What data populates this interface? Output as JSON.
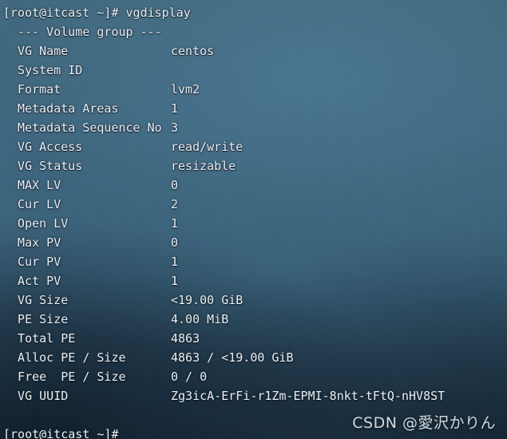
{
  "terminal": {
    "command_line": "[root@itcast ~]# vgdisplay",
    "section_header": "  --- Volume group ---",
    "final_prompt": "[root@itcast ~]#",
    "fields": [
      {
        "label": "  VG Name",
        "value": "centos"
      },
      {
        "label": "  System ID",
        "value": ""
      },
      {
        "label": "  Format",
        "value": "lvm2"
      },
      {
        "label": "  Metadata Areas",
        "value": "1"
      },
      {
        "label": "  Metadata Sequence No",
        "value": "3"
      },
      {
        "label": "  VG Access",
        "value": "read/write"
      },
      {
        "label": "  VG Status",
        "value": "resizable"
      },
      {
        "label": "  MAX LV",
        "value": "0"
      },
      {
        "label": "  Cur LV",
        "value": "2"
      },
      {
        "label": "  Open LV",
        "value": "1"
      },
      {
        "label": "  Max PV",
        "value": "0"
      },
      {
        "label": "  Cur PV",
        "value": "1"
      },
      {
        "label": "  Act PV",
        "value": "1"
      },
      {
        "label": "  VG Size",
        "value": "<19.00 GiB"
      },
      {
        "label": "  PE Size",
        "value": "4.00 MiB"
      },
      {
        "label": "  Total PE",
        "value": "4863"
      },
      {
        "label": "  Alloc PE / Size",
        "value": "4863 / <19.00 GiB"
      },
      {
        "label": "  Free  PE / Size",
        "value": "0 / 0"
      },
      {
        "label": "  VG UUID",
        "value": "Zg3icA-ErFi-r1Zm-EPMI-8nkt-tFtQ-nHV8ST"
      }
    ]
  },
  "watermark": {
    "text": "CSDN @愛沢かりん"
  },
  "colors": {
    "background_center": "#3d6680",
    "background_bottom": "#203a4b",
    "text": "#eef2f5"
  }
}
